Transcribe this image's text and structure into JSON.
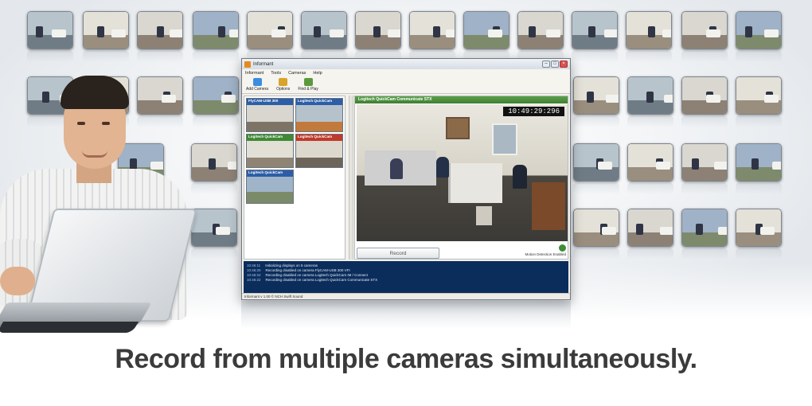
{
  "window": {
    "title": "Informant",
    "menu": [
      "Informant",
      "Tools",
      "Cameras",
      "Help"
    ],
    "toolbar": [
      {
        "label": "Add Camera",
        "icon": "add-camera-icon",
        "color": "#3c8dde"
      },
      {
        "label": "Options",
        "icon": "options-icon",
        "color": "#d9a42b"
      },
      {
        "label": "Find & Play",
        "icon": "find-play-icon",
        "color": "#5b9a3c"
      }
    ],
    "cameras": [
      {
        "label": "FlyCAM-USB 300",
        "color": "#2c5ea8"
      },
      {
        "label": "Logitech QuickCam",
        "color": "#2c5ea8"
      },
      {
        "label": "Logitech QuickCam",
        "color": "#3f8a33"
      },
      {
        "label": "Logitech QuickCam",
        "color": "#c0392b"
      },
      {
        "label": "Logitech QuickCam",
        "color": "#2c5ea8"
      }
    ],
    "viewer": {
      "header": "Logitech QuickCam Communicate STX",
      "clock": "10:49:29:296",
      "record_label": "Record",
      "motion_status": "Motion Detection Enabled"
    },
    "log": [
      {
        "time": "10:46:11",
        "text": "Initializing displays on 5 cameras"
      },
      {
        "time": "10:46:20",
        "text": "Recording disabled on camera FlyCAM-USB 300 VFI"
      },
      {
        "time": "10:46:22",
        "text": "Recording disabled on camera Logitech QuickCam IM / Connect"
      },
      {
        "time": "10:46:22",
        "text": "Recording disabled on camera Logitech QuickCam Communicate STX"
      }
    ],
    "status": "Informant v 1.00 © NCH Swift Sound"
  },
  "tagline": "Record from multiple cameras simultaneously."
}
